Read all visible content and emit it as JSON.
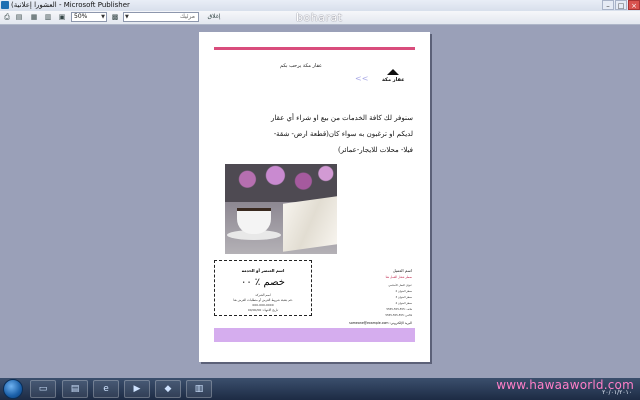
{
  "window": {
    "title": "(العشورا إعلانية - Microsoft Publisher",
    "buttons": {
      "minimize": "–",
      "maximize": "□",
      "close": "×"
    }
  },
  "toolbar": {
    "zoom_value": "50%",
    "font_value": "مرئيك",
    "close_label": "إغلاق",
    "icons": [
      "print-preview-icon",
      "print-icon",
      "page-icon",
      "page-icon",
      "close-page-icon"
    ]
  },
  "watermark_top": "boharat",
  "document": {
    "welcome": "عقار مكة يرحب بكم",
    "logo_text": "عقار مكة",
    "body_lines": [
      "سنوفر لك كافة الخدمات من بيع او شراء أي عقار",
      "لديكم او ترغبون به سواء كان(قطعة ارض- شقة-",
      "فيلا- محلات للايجار-عمائر)"
    ],
    "coupon": {
      "heading": "اسم العنصر أو الخدمة",
      "discount": "خصم ٪ ٠٠",
      "line1": "اسم الشركة",
      "line2": "قم بتعبئة شروط العرض أو متطلبات العرض هنا.",
      "line3": "000-000-0000",
      "line4": "تاريخ الانتهاء: 00/00/00"
    },
    "contact": {
      "name": "اسم العميل",
      "title": "سطر شعار العمل هنا",
      "lines": [
        "عنوان العمل الأساسي",
        "سطر العنوان 2",
        "سطر العنوان 3",
        "سطر العنوان 4",
        "هاتف: 555-555-5555",
        "فاكس: 555-555-5555"
      ],
      "email": "someone@example.com :البريد الإلكتروني"
    }
  },
  "taskbar": {
    "items": [
      "explorer-icon",
      "folder-icon",
      "ie-icon",
      "media-icon",
      "users-icon",
      "publisher-icon"
    ]
  },
  "watermark_bottom": "www.hawaaworld.com",
  "clock": "٢٠/٠١/٢٠١٠"
}
